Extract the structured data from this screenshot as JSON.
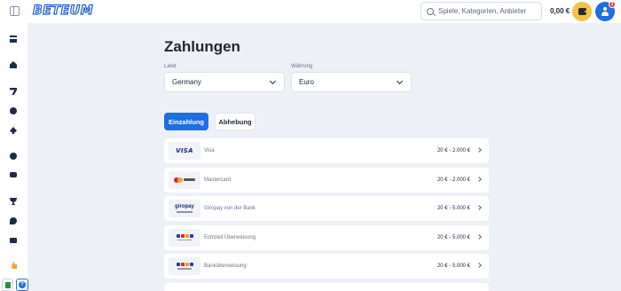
{
  "header": {
    "logo_text": "BETEUM",
    "search_placeholder": "Spiele, Kategorien, Anbieter",
    "balance": "0,00 €",
    "notification_count": "3"
  },
  "sidebar": {
    "items": [
      {
        "icon": "grid-icon"
      },
      {
        "icon": "home-icon"
      },
      {
        "icon": "slot-seven-icon"
      },
      {
        "icon": "casino-chip-icon"
      },
      {
        "icon": "cards-spade-icon"
      },
      {
        "icon": "football-icon"
      },
      {
        "icon": "live-tv-icon"
      },
      {
        "icon": "trophy-icon"
      },
      {
        "icon": "swirl-icon"
      },
      {
        "icon": "bag-icon"
      },
      {
        "icon": "thumbs-up-icon"
      }
    ],
    "help_label": "?"
  },
  "main": {
    "title": "Zahlungen",
    "country": {
      "label": "Land",
      "value": "Germany"
    },
    "currency": {
      "label": "Währung",
      "value": "Euro"
    },
    "tabs": [
      {
        "label": "Einzahlung",
        "active": true
      },
      {
        "label": "Abhebung",
        "active": false
      }
    ],
    "methods": [
      {
        "name": "Visa",
        "range": "20 € - 2.000 €",
        "logo_text": "VISA"
      },
      {
        "name": "Mastercard",
        "range": "20 € - 2.000 €"
      },
      {
        "name": "Giropay von der Bank",
        "range": "20 € - 5.000 €",
        "logo_text": "giropay"
      },
      {
        "name": "Echtzeit Überweisung",
        "range": "20 € - 5.000 €"
      },
      {
        "name": "Banküberweisung",
        "range": "20 € - 5.000 €"
      }
    ]
  },
  "colors": {
    "accent": "#1f6fe0",
    "wallet": "#f6c245",
    "background": "#edf0f6"
  }
}
